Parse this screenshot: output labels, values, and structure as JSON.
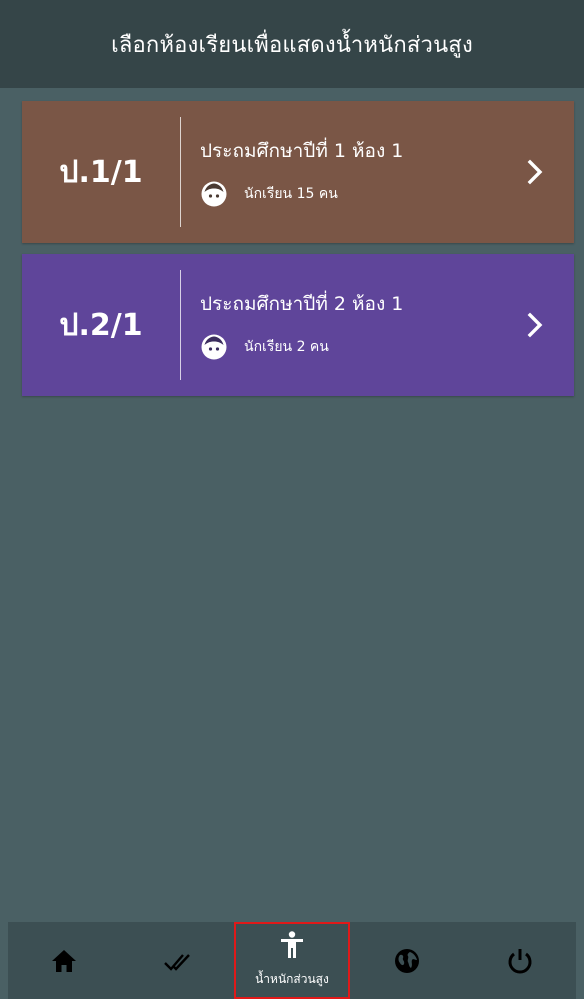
{
  "header": {
    "title": "เลือกห้องเรียนเพื่อแสดงน้ำหนักส่วนสูง"
  },
  "classes": [
    {
      "code": "ป.1/1",
      "name": "ประถมศึกษาปีที่ 1 ห้อง 1",
      "students": "นักเรียน 15 คน",
      "color": "#7a5646"
    },
    {
      "code": "ป.2/1",
      "name": "ประถมศึกษาปีที่ 2 ห้อง 1",
      "students": "นักเรียน 2 คน",
      "color": "#5f459a"
    }
  ],
  "bottom_nav": {
    "items": [
      {
        "icon": "home-icon"
      },
      {
        "icon": "double-check-icon"
      },
      {
        "icon": "accessibility-person-icon",
        "label": "น้ำหนักส่วนสูง",
        "active": true
      },
      {
        "icon": "globe-icon"
      },
      {
        "icon": "power-icon"
      }
    ]
  },
  "colors": {
    "app_bar": "#354548",
    "background": "#4a6064",
    "bottom_nav": "#3c4f53",
    "active_outline": "#e01919"
  }
}
